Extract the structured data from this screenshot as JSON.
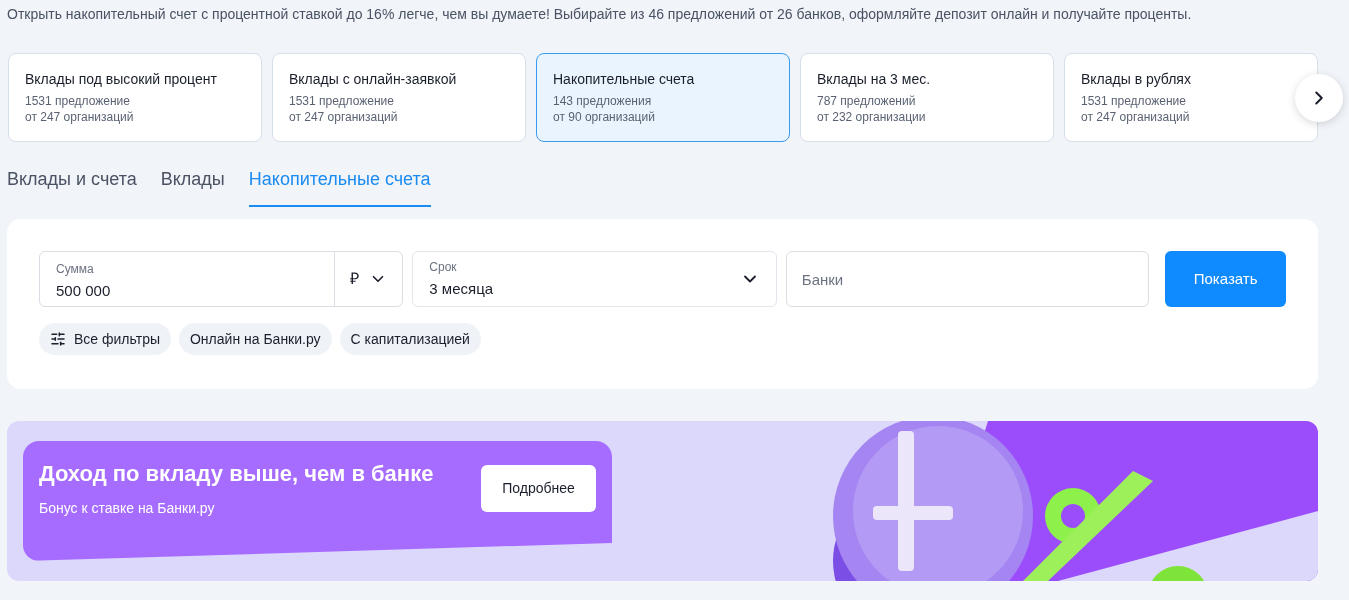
{
  "intro": "Открыть накопительный счет с процентной ставкой до 16% легче, чем вы думаете!  Выбирайте из 46 предложений от 26 банков, оформляйте депозит онлайн и получайте проценты.",
  "categories": [
    {
      "title": "Вклады под высокий процент",
      "offers": "1531 предложение",
      "orgs": "от 247 организаций",
      "selected": false
    },
    {
      "title": "Вклады с онлайн-заявкой",
      "offers": "1531 предложение",
      "orgs": "от 247 организаций",
      "selected": false
    },
    {
      "title": "Накопительные счета",
      "offers": "143 предложения",
      "orgs": "от 90 организаций",
      "selected": true
    },
    {
      "title": "Вклады на 3 мес.",
      "offers": "787 предложений",
      "orgs": "от 232 организации",
      "selected": false
    },
    {
      "title": "Вклады в рублях",
      "offers": "1531 предложение",
      "orgs": "от 247 организаций",
      "selected": false
    }
  ],
  "tabs": [
    {
      "label": "Вклады и счета",
      "selected": false
    },
    {
      "label": "Вклады",
      "selected": false
    },
    {
      "label": "Накопительные счета",
      "selected": true
    }
  ],
  "search": {
    "amount": {
      "label": "Сумма",
      "value": "500 000",
      "currency": "₽"
    },
    "term": {
      "label": "Срок",
      "value": "3 месяца"
    },
    "banks": {
      "placeholder": "Банки"
    },
    "submit": "Показать",
    "chips": [
      {
        "label": "Все фильтры",
        "kind": "filters"
      },
      {
        "label": "Онлайн на Банки.ру",
        "kind": "plain"
      },
      {
        "label": "С капитализацией",
        "kind": "plain"
      }
    ]
  },
  "banner": {
    "title": "Доход по вкладу выше, чем в банке",
    "subtitle": "Бонус к ставке на Банки.ру",
    "button": "Подробнее"
  }
}
